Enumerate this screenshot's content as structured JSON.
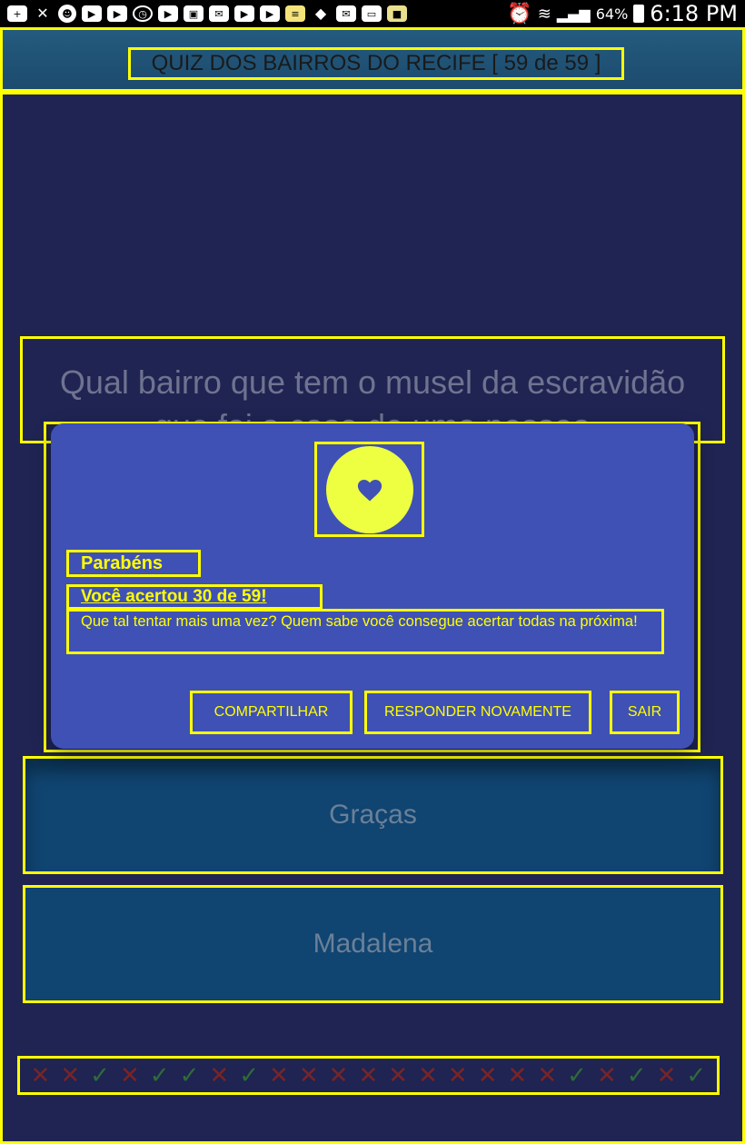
{
  "status_bar": {
    "battery_percent": "64%",
    "time": "6:18 PM",
    "icons": [
      "add-box-icon",
      "tool-icon",
      "face-icon",
      "video-icon",
      "video-icon",
      "alarm-icon",
      "video-icon",
      "image-icon",
      "mail-icon",
      "video-icon",
      "video-icon",
      "book-icon",
      "bell-icon",
      "mail-icon",
      "laptop-icon",
      "app-icon",
      "alarm-clock-icon",
      "wifi-icon",
      "signal-icon",
      "battery-icon"
    ]
  },
  "header": {
    "title": "QUIZ DOS BAIRROS DO RECIFE [ 59 de 59 ]"
  },
  "question": {
    "text": "Qual bairro que tem o musel da escravidão que foi a casa de uma pessoa"
  },
  "answers": [
    {
      "label": "Graças"
    },
    {
      "label": "Madalena"
    }
  ],
  "dialog": {
    "icon": "heart-icon",
    "title": "Parabéns",
    "score": "Você acertou 30 de 59!",
    "message": "Que tal tentar mais uma vez? Quem sabe você consegue acertar todas na próxima!",
    "buttons": {
      "share": "COMPARTILHAR",
      "retry": "RESPONDER NOVAMENTE",
      "exit": "SAIR"
    }
  },
  "progress": {
    "marks": [
      "wrong",
      "wrong",
      "right",
      "wrong",
      "right",
      "right",
      "wrong",
      "right",
      "wrong",
      "wrong",
      "wrong",
      "wrong",
      "wrong",
      "wrong",
      "wrong",
      "wrong",
      "wrong",
      "wrong",
      "right",
      "wrong",
      "right",
      "wrong",
      "right"
    ],
    "colors": {
      "wrong": "#7a2424",
      "right": "#2f6b3a"
    }
  },
  "colors": {
    "background": "#1f2452",
    "header": "#245b7e",
    "dialog": "#3f51b5",
    "accent": "#ffff00",
    "icon_circle": "#eeff41",
    "answer": "#104471"
  }
}
